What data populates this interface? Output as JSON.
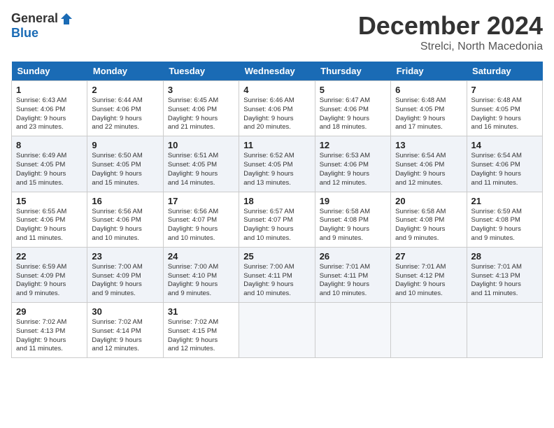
{
  "header": {
    "logo_general": "General",
    "logo_blue": "Blue",
    "month": "December 2024",
    "location": "Strelci, North Macedonia"
  },
  "days_of_week": [
    "Sunday",
    "Monday",
    "Tuesday",
    "Wednesday",
    "Thursday",
    "Friday",
    "Saturday"
  ],
  "weeks": [
    [
      {
        "day": "1",
        "info": "Sunrise: 6:43 AM\nSunset: 4:06 PM\nDaylight: 9 hours\nand 23 minutes."
      },
      {
        "day": "2",
        "info": "Sunrise: 6:44 AM\nSunset: 4:06 PM\nDaylight: 9 hours\nand 22 minutes."
      },
      {
        "day": "3",
        "info": "Sunrise: 6:45 AM\nSunset: 4:06 PM\nDaylight: 9 hours\nand 21 minutes."
      },
      {
        "day": "4",
        "info": "Sunrise: 6:46 AM\nSunset: 4:06 PM\nDaylight: 9 hours\nand 20 minutes."
      },
      {
        "day": "5",
        "info": "Sunrise: 6:47 AM\nSunset: 4:06 PM\nDaylight: 9 hours\nand 18 minutes."
      },
      {
        "day": "6",
        "info": "Sunrise: 6:48 AM\nSunset: 4:05 PM\nDaylight: 9 hours\nand 17 minutes."
      },
      {
        "day": "7",
        "info": "Sunrise: 6:48 AM\nSunset: 4:05 PM\nDaylight: 9 hours\nand 16 minutes."
      }
    ],
    [
      {
        "day": "8",
        "info": "Sunrise: 6:49 AM\nSunset: 4:05 PM\nDaylight: 9 hours\nand 15 minutes."
      },
      {
        "day": "9",
        "info": "Sunrise: 6:50 AM\nSunset: 4:05 PM\nDaylight: 9 hours\nand 15 minutes."
      },
      {
        "day": "10",
        "info": "Sunrise: 6:51 AM\nSunset: 4:05 PM\nDaylight: 9 hours\nand 14 minutes."
      },
      {
        "day": "11",
        "info": "Sunrise: 6:52 AM\nSunset: 4:05 PM\nDaylight: 9 hours\nand 13 minutes."
      },
      {
        "day": "12",
        "info": "Sunrise: 6:53 AM\nSunset: 4:06 PM\nDaylight: 9 hours\nand 12 minutes."
      },
      {
        "day": "13",
        "info": "Sunrise: 6:54 AM\nSunset: 4:06 PM\nDaylight: 9 hours\nand 12 minutes."
      },
      {
        "day": "14",
        "info": "Sunrise: 6:54 AM\nSunset: 4:06 PM\nDaylight: 9 hours\nand 11 minutes."
      }
    ],
    [
      {
        "day": "15",
        "info": "Sunrise: 6:55 AM\nSunset: 4:06 PM\nDaylight: 9 hours\nand 11 minutes."
      },
      {
        "day": "16",
        "info": "Sunrise: 6:56 AM\nSunset: 4:06 PM\nDaylight: 9 hours\nand 10 minutes."
      },
      {
        "day": "17",
        "info": "Sunrise: 6:56 AM\nSunset: 4:07 PM\nDaylight: 9 hours\nand 10 minutes."
      },
      {
        "day": "18",
        "info": "Sunrise: 6:57 AM\nSunset: 4:07 PM\nDaylight: 9 hours\nand 10 minutes."
      },
      {
        "day": "19",
        "info": "Sunrise: 6:58 AM\nSunset: 4:08 PM\nDaylight: 9 hours\nand 9 minutes."
      },
      {
        "day": "20",
        "info": "Sunrise: 6:58 AM\nSunset: 4:08 PM\nDaylight: 9 hours\nand 9 minutes."
      },
      {
        "day": "21",
        "info": "Sunrise: 6:59 AM\nSunset: 4:08 PM\nDaylight: 9 hours\nand 9 minutes."
      }
    ],
    [
      {
        "day": "22",
        "info": "Sunrise: 6:59 AM\nSunset: 4:09 PM\nDaylight: 9 hours\nand 9 minutes."
      },
      {
        "day": "23",
        "info": "Sunrise: 7:00 AM\nSunset: 4:09 PM\nDaylight: 9 hours\nand 9 minutes."
      },
      {
        "day": "24",
        "info": "Sunrise: 7:00 AM\nSunset: 4:10 PM\nDaylight: 9 hours\nand 9 minutes."
      },
      {
        "day": "25",
        "info": "Sunrise: 7:00 AM\nSunset: 4:11 PM\nDaylight: 9 hours\nand 10 minutes."
      },
      {
        "day": "26",
        "info": "Sunrise: 7:01 AM\nSunset: 4:11 PM\nDaylight: 9 hours\nand 10 minutes."
      },
      {
        "day": "27",
        "info": "Sunrise: 7:01 AM\nSunset: 4:12 PM\nDaylight: 9 hours\nand 10 minutes."
      },
      {
        "day": "28",
        "info": "Sunrise: 7:01 AM\nSunset: 4:13 PM\nDaylight: 9 hours\nand 11 minutes."
      }
    ],
    [
      {
        "day": "29",
        "info": "Sunrise: 7:02 AM\nSunset: 4:13 PM\nDaylight: 9 hours\nand 11 minutes."
      },
      {
        "day": "30",
        "info": "Sunrise: 7:02 AM\nSunset: 4:14 PM\nDaylight: 9 hours\nand 12 minutes."
      },
      {
        "day": "31",
        "info": "Sunrise: 7:02 AM\nSunset: 4:15 PM\nDaylight: 9 hours\nand 12 minutes."
      },
      {
        "day": "",
        "info": ""
      },
      {
        "day": "",
        "info": ""
      },
      {
        "day": "",
        "info": ""
      },
      {
        "day": "",
        "info": ""
      }
    ]
  ]
}
